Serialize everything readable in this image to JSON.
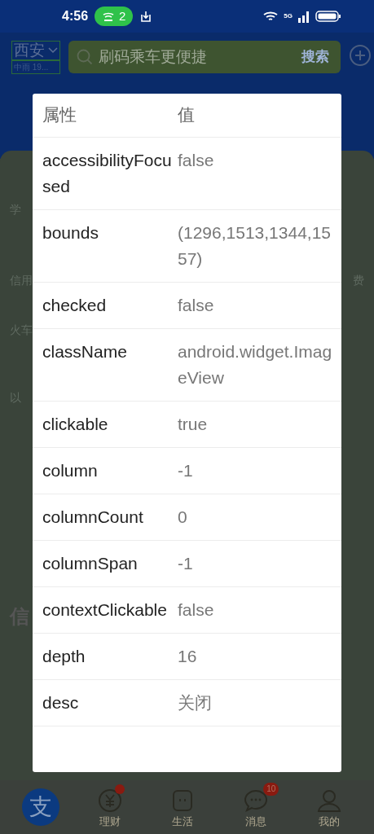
{
  "status_bar": {
    "time": "4:56",
    "hotspot_count": "2",
    "network": "5G"
  },
  "header": {
    "city": "西安",
    "weather": "中雨 19...",
    "search": {
      "placeholder": "刷码乘车更便捷"
    },
    "search_button": "搜索"
  },
  "background_fragments": [
    {
      "kind": "label",
      "text": "学"
    },
    {
      "kind": "label",
      "text": "信用",
      "right": "费"
    },
    {
      "kind": "label",
      "text": "火车"
    },
    {
      "kind": "label",
      "text": "以"
    },
    {
      "kind": "heading",
      "text": "信"
    }
  ],
  "properties_dialog": {
    "columns": [
      "属性",
      "值"
    ],
    "rows": [
      {
        "name": "accessibilityFocused",
        "value": "false"
      },
      {
        "name": "bounds",
        "value": "(1296,1513,1344,1557)"
      },
      {
        "name": "checked",
        "value": "false"
      },
      {
        "name": "className",
        "value": "android.widget.ImageView"
      },
      {
        "name": "clickable",
        "value": "true"
      },
      {
        "name": "column",
        "value": "-1"
      },
      {
        "name": "columnCount",
        "value": "0"
      },
      {
        "name": "columnSpan",
        "value": "-1"
      },
      {
        "name": "contextClickable",
        "value": "false"
      },
      {
        "name": "depth",
        "value": "16"
      },
      {
        "name": "desc",
        "value": "关闭"
      }
    ]
  },
  "bottom_nav": [
    {
      "kind": "logo",
      "label": "支"
    },
    {
      "kind": "finance",
      "label": "理财",
      "dot": true
    },
    {
      "kind": "life",
      "label": "生活"
    },
    {
      "kind": "messages",
      "label": "消息",
      "badge": "10"
    },
    {
      "kind": "profile",
      "label": "我的"
    }
  ]
}
